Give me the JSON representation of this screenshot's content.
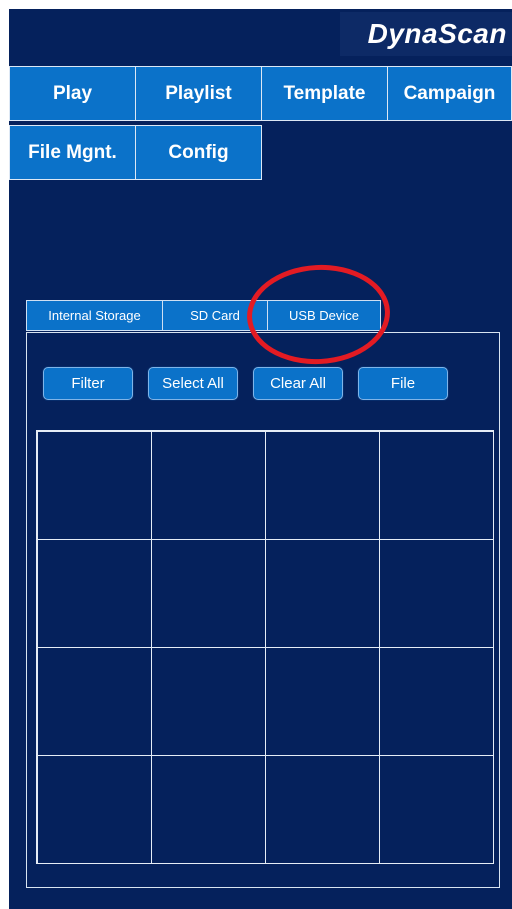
{
  "brand": {
    "logo_text": "DynaScan"
  },
  "nav": {
    "items": [
      {
        "label": "Play"
      },
      {
        "label": "Playlist"
      },
      {
        "label": "Template"
      },
      {
        "label": "Campaign"
      },
      {
        "label": "File Mgnt."
      },
      {
        "label": "Config"
      }
    ]
  },
  "storage_tabs": {
    "items": [
      {
        "label": "Internal Storage"
      },
      {
        "label": "SD Card"
      },
      {
        "label": "USB Device"
      }
    ],
    "highlighted": "USB Device"
  },
  "actions": {
    "filter": "Filter",
    "select_all": "Select All",
    "clear_all": "Clear All",
    "file": "File"
  },
  "file_grid": {
    "rows": 4,
    "columns": 4
  },
  "colors": {
    "background": "#05215c",
    "button_blue": "#0b72c9",
    "highlight_red": "#e31b23",
    "border_light": "#e6edf6"
  }
}
